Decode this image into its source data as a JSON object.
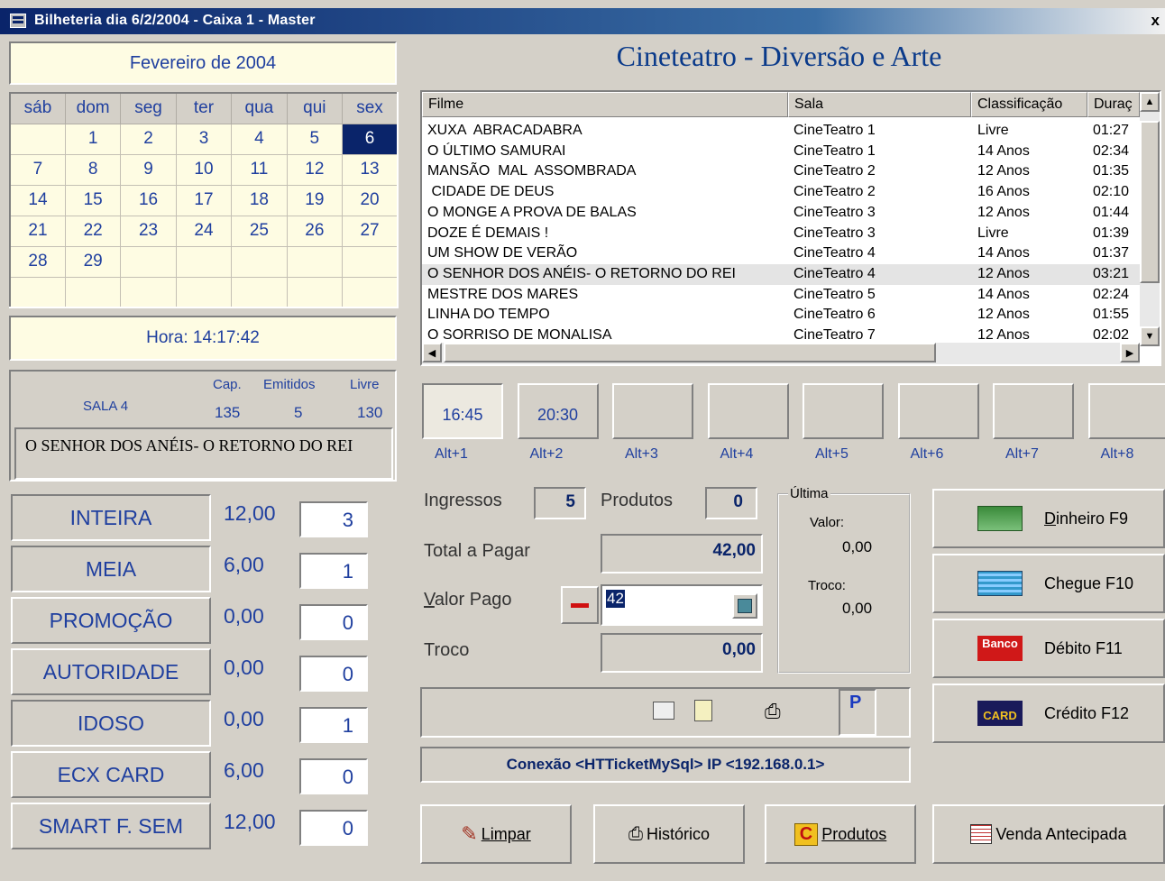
{
  "window": {
    "title": "Bilheteria dia 6/2/2004  -  Caixa 1  -  Master",
    "close": "x"
  },
  "calendar": {
    "month_label": "Fevereiro de 2004",
    "weekdays": [
      "sáb",
      "dom",
      "seg",
      "ter",
      "qua",
      "qui",
      "sex"
    ],
    "weeks": [
      [
        "",
        "1",
        "2",
        "3",
        "4",
        "5",
        "6"
      ],
      [
        "7",
        "8",
        "9",
        "10",
        "11",
        "12",
        "13"
      ],
      [
        "14",
        "15",
        "16",
        "17",
        "18",
        "19",
        "20"
      ],
      [
        "21",
        "22",
        "23",
        "24",
        "25",
        "26",
        "27"
      ],
      [
        "28",
        "29",
        "",
        "",
        "",
        "",
        ""
      ],
      [
        "",
        "",
        "",
        "",
        "",
        "",
        ""
      ]
    ],
    "selected_day": "6"
  },
  "clock": {
    "text": "Hora: 14:17:42"
  },
  "room": {
    "name": "SALA 4",
    "cap_label": "Cap.",
    "cap": "135",
    "emitidos_label": "Emitidos",
    "emitidos": "5",
    "livre_label": "Livre",
    "livre": "130",
    "movie": "O SENHOR DOS ANÉIS- O RETORNO DO REI"
  },
  "header": {
    "title": "Cineteatro - Diversão e Arte"
  },
  "movies": {
    "columns": [
      "Filme",
      "Sala",
      "Classificação",
      "Duraç"
    ],
    "rows": [
      [
        "XUXA  ABRACADABRA",
        "CineTeatro 1",
        "Livre",
        "01:27"
      ],
      [
        "O ÚLTIMO SAMURAI",
        "CineTeatro 1",
        "14 Anos",
        "02:34"
      ],
      [
        "MANSÃO  MAL  ASSOMBRADA",
        "CineTeatro 2",
        "12 Anos",
        "01:35"
      ],
      [
        " CIDADE DE DEUS",
        "CineTeatro 2",
        "16 Anos",
        "02:10"
      ],
      [
        "O MONGE A PROVA DE BALAS",
        "CineTeatro 3",
        "12 Anos",
        "01:44"
      ],
      [
        "DOZE É DEMAIS !",
        "CineTeatro 3",
        "Livre",
        "01:39"
      ],
      [
        "UM SHOW DE VERÃO",
        "CineTeatro 4",
        "14 Anos",
        "01:37"
      ],
      [
        "O SENHOR DOS ANÉIS- O RETORNO DO REI",
        "CineTeatro 4",
        "12 Anos",
        "03:21"
      ],
      [
        "MESTRE DOS MARES",
        "CineTeatro 5",
        "14 Anos",
        "02:24"
      ],
      [
        "LINHA DO TEMPO",
        "CineTeatro 6",
        "12 Anos",
        "01:55"
      ],
      [
        "O SORRISO DE MONALISA",
        "CineTeatro 7",
        "12 Anos",
        "02:02"
      ]
    ],
    "selected_index": 7
  },
  "sessions": {
    "times": [
      "16:45",
      "20:30",
      "",
      "",
      "",
      "",
      "",
      ""
    ],
    "shortcuts": [
      "Alt+1",
      "Alt+2",
      "Alt+3",
      "Alt+4",
      "Alt+5",
      "Alt+6",
      "Alt+7",
      "Alt+8"
    ]
  },
  "tickets": [
    {
      "label": "INTEIRA",
      "price": "12,00",
      "qty": "3"
    },
    {
      "label": "MEIA",
      "price": "6,00",
      "qty": "1"
    },
    {
      "label": "PROMOÇÃO",
      "price": "0,00",
      "qty": "0"
    },
    {
      "label": "AUTORIDADE",
      "price": "0,00",
      "qty": "0"
    },
    {
      "label": "IDOSO",
      "price": "0,00",
      "qty": "1"
    },
    {
      "label": "ECX CARD",
      "price": "6,00",
      "qty": "0"
    },
    {
      "label": "SMART F. SEM",
      "price": "12,00",
      "qty": "0"
    }
  ],
  "payment": {
    "ingressos_label": "Ingressos",
    "ingressos": "5",
    "produtos_label": "Produtos",
    "produtos": "0",
    "total_label": "Total a Pagar",
    "total": "42,00",
    "pago_label": "Valor Pago",
    "pago": "42",
    "troco_label": "Troco",
    "troco": "0,00",
    "ultima": {
      "legend": "Última",
      "valor_label": "Valor:",
      "valor": "0,00",
      "troco_label": "Troco:",
      "troco": "0,00"
    }
  },
  "pay_methods": [
    {
      "label": "Dinheiro  F9",
      "key_letter": "D",
      "icon": "money-icon"
    },
    {
      "label": "Chegue  F10",
      "icon": "check-icon"
    },
    {
      "label": "Débito  F11",
      "icon": "bank-icon",
      "icon_text": "Banco"
    },
    {
      "label": "Crédito  F12",
      "icon": "card-icon",
      "icon_text": "CARD"
    }
  ],
  "status": {
    "p_label": "P",
    "connection": "Conexão <HTTicketMySql> IP <192.168.0.1>"
  },
  "actions": [
    {
      "label": "Limpar",
      "icon": "broom-icon"
    },
    {
      "label": "Histórico",
      "icon": "history-icon"
    },
    {
      "label": "Produtos",
      "icon": "products-icon"
    },
    {
      "label": "Venda Antecipada",
      "icon": "calendar-icon"
    }
  ],
  "colors": {
    "accent": "#1f3f9f",
    "title_bar": "#0a246a",
    "cream": "#fefce3",
    "face": "#d4d0c8"
  }
}
